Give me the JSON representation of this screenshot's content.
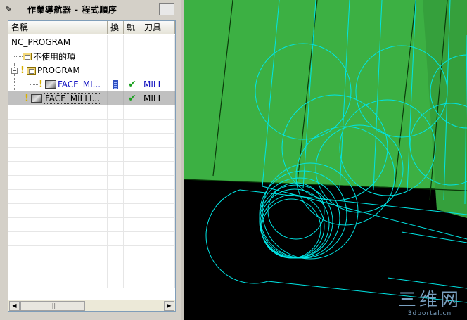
{
  "navigator": {
    "title": "作業導航器 - 程式順序",
    "columns": [
      "名稱",
      "換",
      "軌",
      "刀具"
    ],
    "rows": [
      {
        "name": "NC_PROGRAM",
        "swap": "",
        "path": "",
        "tool": ""
      },
      {
        "name": "不使用的項",
        "swap": "",
        "path": "",
        "tool": ""
      },
      {
        "name": "PROGRAM",
        "swap": "",
        "path": "",
        "tool": ""
      },
      {
        "name": "FACE_MI...",
        "swap": "",
        "path": "✔",
        "tool": "MILL"
      },
      {
        "name": "FACE_MILLI...",
        "swap": "",
        "path": "✔",
        "tool": "MILL"
      }
    ],
    "scroll_left_icon": "◀",
    "scroll_right_icon": "▶",
    "scroll_thumb_grip": "|||"
  },
  "watermark": {
    "line1": "三维网",
    "line2": "3dportal.cn"
  },
  "colors": {
    "part_green": "#3cb043",
    "toolpath_cyan": "#00e5e5",
    "background": "#000000",
    "selection": "#c0c0c0"
  }
}
